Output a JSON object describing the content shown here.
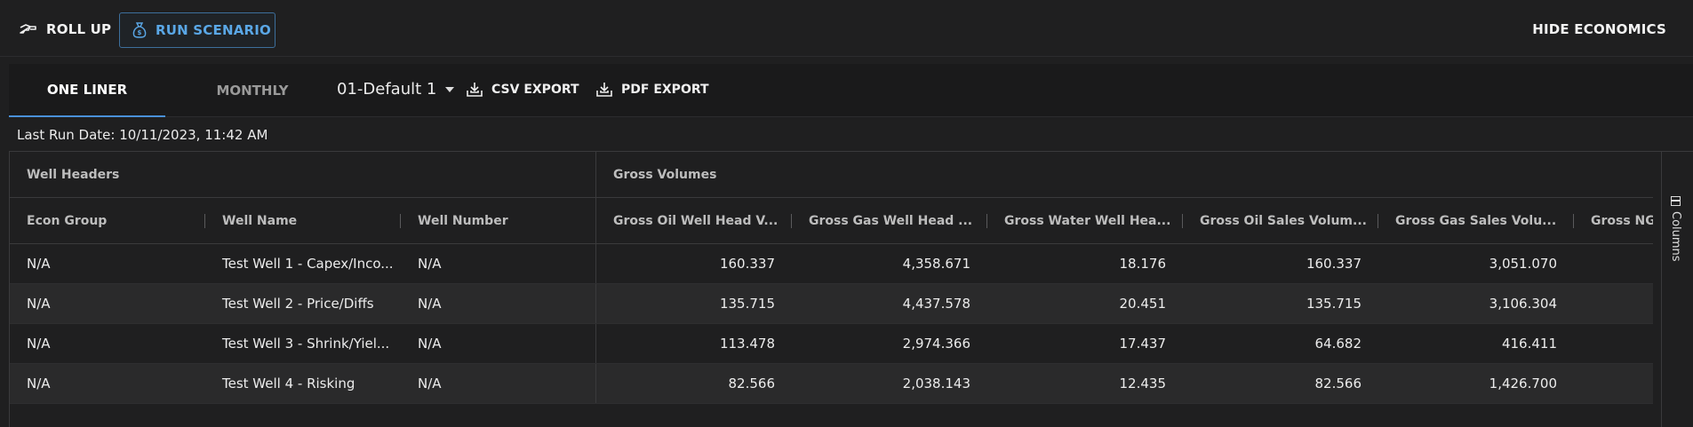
{
  "toolbar": {
    "roll_up": "ROLL UP",
    "run_scenario": "RUN SCENARIO",
    "hide_economics": "HIDE ECONOMICS"
  },
  "tabs": {
    "one_liner": "ONE LINER",
    "monthly": "MONTHLY",
    "active": "ONE LINER"
  },
  "scenario_select": {
    "value": "01-Default 1"
  },
  "exports": {
    "csv": "CSV EXPORT",
    "pdf": "PDF EXPORT"
  },
  "last_run": "Last Run Date: 10/11/2023, 11:42 AM",
  "grid": {
    "groups": [
      "Well Headers",
      "Gross Volumes"
    ],
    "columns": [
      "Econ Group",
      "Well Name",
      "Well Number",
      "Gross Oil Well Head V...",
      "Gross Gas Well Head ...",
      "Gross Water Well Hea...",
      "Gross Oil Sales Volum...",
      "Gross Gas Sales Volu...",
      "Gross NGL"
    ],
    "rows": [
      [
        "N/A",
        "Test Well 1 - Capex/Inco...",
        "N/A",
        "160.337",
        "4,358.671",
        "18.176",
        "160.337",
        "3,051.070"
      ],
      [
        "N/A",
        "Test Well 2 - Price/Diffs",
        "N/A",
        "135.715",
        "4,437.578",
        "20.451",
        "135.715",
        "3,106.304"
      ],
      [
        "N/A",
        "Test Well 3 - Shrink/Yiel...",
        "N/A",
        "113.478",
        "2,974.366",
        "17.437",
        "64.682",
        "416.411"
      ],
      [
        "N/A",
        "Test Well 4 - Risking",
        "N/A",
        "82.566",
        "2,038.143",
        "12.435",
        "82.566",
        "1,426.700"
      ]
    ],
    "columns_panel": "Columns"
  },
  "colors": {
    "accent": "#4a90d9",
    "run_scenario": "#5aa7e6",
    "background": "#1f1f20"
  }
}
